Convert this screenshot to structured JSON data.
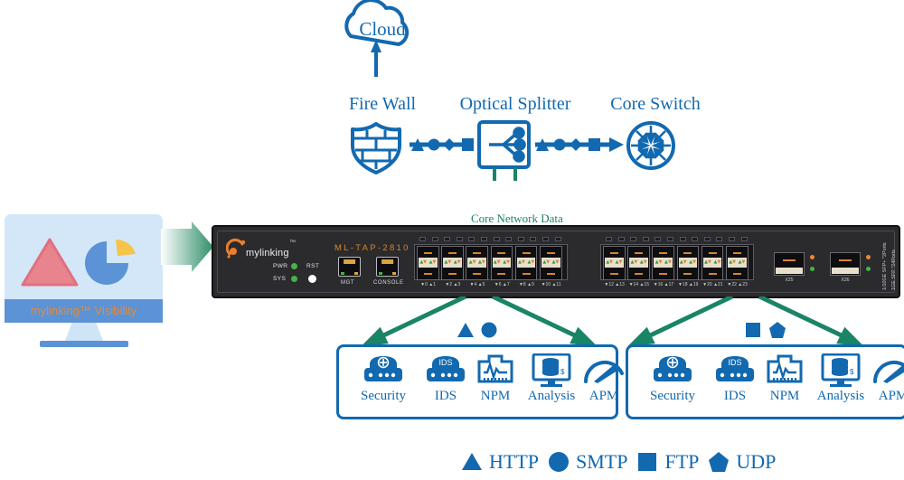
{
  "meta": {
    "brand_blue": "#1269B0",
    "flow_green": "#1A8466",
    "device_orange": "#d8852a"
  },
  "topology": {
    "cloud": {
      "label": "Cloud",
      "icon": "cloud-icon"
    },
    "firewall": {
      "label": "Fire Wall",
      "icon": "shield-brick-icon"
    },
    "splitter": {
      "label": "Optical Splitter",
      "icon": "optical-splitter-icon"
    },
    "core_switch": {
      "label": "Core Switch",
      "icon": "core-switch-icon"
    },
    "tap_feed_label": "Core Network Data"
  },
  "device": {
    "brand": "mylinking",
    "model": "ML-TAP-2810",
    "leds": [
      {
        "label": "PWR",
        "color": "#49b04a"
      },
      {
        "label": "SYS",
        "color": "#49b04a"
      },
      {
        "label": "RST",
        "color": "#ffffff"
      }
    ],
    "ports": [
      {
        "label": "MGT"
      },
      {
        "label": "CONSOLE"
      }
    ],
    "sfp_group_left_numbers": [
      "0",
      "1",
      "2",
      "3",
      "4",
      "5",
      "6",
      "7",
      "8",
      "9",
      "10",
      "11"
    ],
    "sfp_group_right_numbers": [
      "12",
      "13",
      "14",
      "15",
      "16",
      "17",
      "18",
      "19",
      "20",
      "21",
      "22",
      "23"
    ],
    "sfp_plus_labels": [
      "X25",
      "X26"
    ],
    "side_text_top": "1/10GE SFP+ *2Ports",
    "side_text_bottom": "1GE SFP *24Ports"
  },
  "monitor": {
    "caption": "mylinking™ Visibility"
  },
  "toolboxes": [
    {
      "id": "toolbox-left",
      "markers": [
        "triangle",
        "circle"
      ],
      "tools": [
        {
          "name": "Security",
          "icon": "security-shield-icon"
        },
        {
          "name": "IDS",
          "icon": "ids-appliance-icon"
        },
        {
          "name": "NPM",
          "icon": "npm-monitor-icon"
        },
        {
          "name": "Analysis",
          "icon": "analysis-database-icon"
        },
        {
          "name": "APM",
          "icon": "apm-gauge-icon"
        }
      ]
    },
    {
      "id": "toolbox-right",
      "markers": [
        "square",
        "pentagon"
      ],
      "tools": [
        {
          "name": "Security",
          "icon": "security-shield-icon"
        },
        {
          "name": "IDS",
          "icon": "ids-appliance-icon"
        },
        {
          "name": "NPM",
          "icon": "npm-monitor-icon"
        },
        {
          "name": "Analysis",
          "icon": "analysis-database-icon"
        },
        {
          "name": "APM",
          "icon": "apm-gauge-icon"
        }
      ]
    }
  ],
  "legend": [
    {
      "shape": "triangle",
      "label": "HTTP"
    },
    {
      "shape": "circle",
      "label": "SMTP"
    },
    {
      "shape": "square",
      "label": "FTP"
    },
    {
      "shape": "pentagon",
      "label": "UDP"
    }
  ]
}
